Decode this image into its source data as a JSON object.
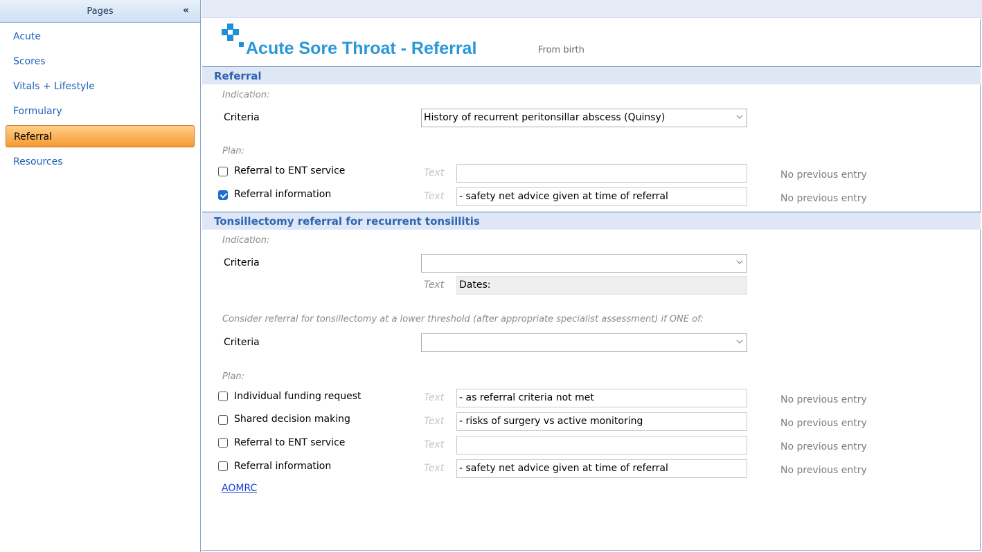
{
  "sidebar": {
    "header": "Pages",
    "collapse_icon": "double-chevron-left-icon",
    "items": [
      {
        "label": "Acute",
        "active": false
      },
      {
        "label": "Scores",
        "active": false
      },
      {
        "label": "Vitals + Lifestyle",
        "active": false
      },
      {
        "label": "Formulary",
        "active": false
      },
      {
        "label": "Referral",
        "active": true
      },
      {
        "label": "Resources",
        "active": false
      }
    ]
  },
  "header": {
    "logo_icon": "medical-cross-icon",
    "title": "Acute Sore Throat - Referral",
    "subtitle": "From birth"
  },
  "referral": {
    "title": "Referral",
    "indication_label": "Indication:",
    "criteria_label": "Criteria",
    "criteria_value": "History of recurrent peritonsillar abscess (Quinsy)",
    "plan_label": "Plan:",
    "rows": [
      {
        "label": "Referral to ENT service",
        "checked": false,
        "text_label": "Text",
        "text_value": "",
        "previous": "No previous entry"
      },
      {
        "label": "Referral information",
        "checked": true,
        "text_label": "Text",
        "text_value": "- safety net advice given at time of referral",
        "previous": "No previous entry"
      }
    ]
  },
  "tonsillectomy": {
    "title": "Tonsillectomy referral for recurrent tonsillitis",
    "indication_label": "Indication:",
    "criteria_label": "Criteria",
    "criteria_value": "",
    "dates_text_label": "Text",
    "dates_value": "Dates:",
    "lower_threshold_note": "Consider referral for tonsillectomy at a lower threshold (after appropriate specialist assessment) if ONE of:",
    "criteria2_label": "Criteria",
    "criteria2_value": "",
    "plan_label": "Plan:",
    "rows": [
      {
        "label": "Individual funding request",
        "checked": false,
        "text_label": "Text",
        "text_value": "- as referral criteria not met",
        "previous": "No previous entry"
      },
      {
        "label": "Shared decision making",
        "checked": false,
        "text_label": "Text",
        "text_value": "- risks of surgery vs active monitoring",
        "previous": "No previous entry"
      },
      {
        "label": "Referral to ENT service",
        "checked": false,
        "text_label": "Text",
        "text_value": "",
        "previous": "No previous entry"
      },
      {
        "label": "Referral information",
        "checked": false,
        "text_label": "Text",
        "text_value": "- safety net advice given at time of referral",
        "previous": "No previous entry"
      }
    ],
    "link": "AOMRC"
  },
  "colors": {
    "accent": "#2a97d6",
    "section_title": "#2e63b5",
    "active_nav": "#f59a2c",
    "link": "#1a3fd6"
  }
}
